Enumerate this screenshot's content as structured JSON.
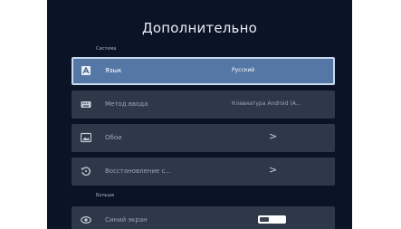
{
  "header": {
    "title": "Дополнительно"
  },
  "sections": {
    "system": "Система",
    "second": "Больше"
  },
  "rows": [
    {
      "label": "Язык",
      "value": "Русский",
      "icon": "language-icon",
      "selected": true
    },
    {
      "label": "Метод ввода",
      "value": "Клавиатура Android (A...",
      "icon": "keyboard-icon"
    },
    {
      "label": "Обои",
      "value": ">",
      "icon": "wallpaper-icon"
    },
    {
      "label": "Восстановление с...",
      "value": ">",
      "icon": "restore-icon"
    },
    {
      "label": "Синий экран",
      "icon": "eye-icon",
      "toggle": "off"
    }
  ],
  "colors": {
    "background": "#0b1326",
    "row": "#2f3849",
    "selected_row": "#5577a6",
    "selected_border": "#c9daf0"
  }
}
